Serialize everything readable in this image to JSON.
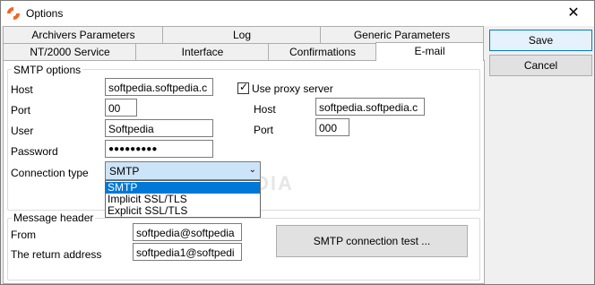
{
  "window": {
    "title": "Options"
  },
  "tabs": {
    "row1": [
      "Archivers Parameters",
      "Log",
      "Generic Parameters"
    ],
    "row2": [
      "NT/2000 Service",
      "Interface",
      "Confirmations",
      "E-mail"
    ],
    "active": "E-mail"
  },
  "smtp": {
    "legend": "SMTP options",
    "host_label": "Host",
    "host_value": "softpedia.softpedia.c",
    "port_label": "Port",
    "port_value": "00",
    "user_label": "User",
    "user_value": "Softpedia",
    "password_label": "Password",
    "password_value": "●●●●●●●●●",
    "use_proxy_label": "Use proxy server",
    "use_proxy_checked": true,
    "proxy_host_label": "Host",
    "proxy_host_value": "softpedia.softpedia.c",
    "proxy_port_label": "Port",
    "proxy_port_value": "000",
    "conn_type_label": "Connection type",
    "conn_type_value": "SMTP",
    "conn_type_options": [
      "SMTP",
      "Implicit SSL/TLS",
      "Explicit SSL/TLS"
    ]
  },
  "message_header": {
    "legend": "Message header",
    "from_label": "From",
    "from_value": "softpedia@softpedia",
    "return_label": "The return address",
    "return_value": "softpedia1@softpedi",
    "test_button": "SMTP connection test ..."
  },
  "buttons": {
    "save": "Save",
    "cancel": "Cancel"
  },
  "watermark": "SOFTPEDIA"
}
